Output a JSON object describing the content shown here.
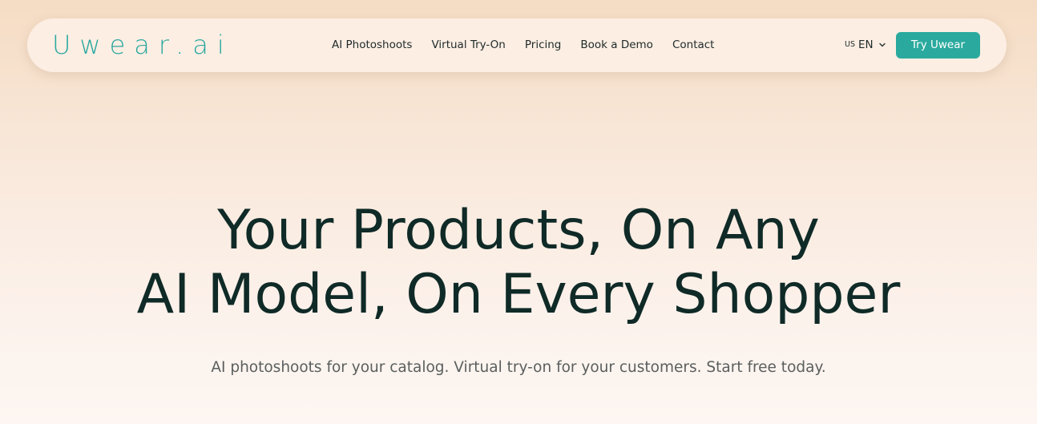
{
  "navbar": {
    "logo": "Uwear.ai",
    "links": [
      "AI Photoshoots",
      "Virtual Try-On",
      "Pricing",
      "Book a Demo",
      "Contact"
    ],
    "language": {
      "flag": "US",
      "code": "EN"
    },
    "cta_label": "Try Uwear"
  },
  "hero": {
    "title_line1": "Your Products, On Any",
    "title_line2": "AI Model, On Every Shopper",
    "subtitle": "AI photoshoots for your catalog. Virtual try-on for your customers. Start free today."
  },
  "colors": {
    "accent": "#2aaa9e",
    "heading": "#0f2a27",
    "navbar_bg": "#fdeee3"
  },
  "icons": {
    "language_dropdown": "chevron-down-icon"
  }
}
